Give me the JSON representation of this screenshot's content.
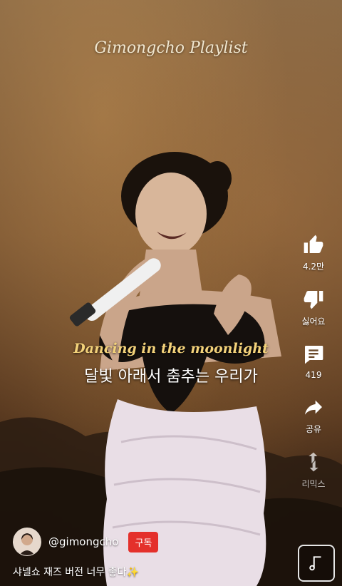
{
  "video": {
    "title_overlay": "Gimongcho Playlist",
    "lyric_english": "Dancing in the moonlight",
    "lyric_korean": "달빛 아래서 춤추는 우리가"
  },
  "actions": {
    "like": {
      "icon": "thumbs-up-icon",
      "label": "4.2만"
    },
    "dislike": {
      "icon": "thumbs-down-icon",
      "label": "싫어요"
    },
    "comments": {
      "icon": "comment-icon",
      "label": "419"
    },
    "share": {
      "icon": "share-arrow-icon",
      "label": "공유"
    },
    "remix": {
      "icon": "remix-icon",
      "label": "리믹스"
    }
  },
  "channel": {
    "handle": "@gimongcho",
    "subscribe_label": "구독"
  },
  "caption": "샤넬쇼 재즈 버전 너무 좋다✨",
  "colors": {
    "subscribe": "#e4302b",
    "lyric_english": "#f3d27a"
  }
}
